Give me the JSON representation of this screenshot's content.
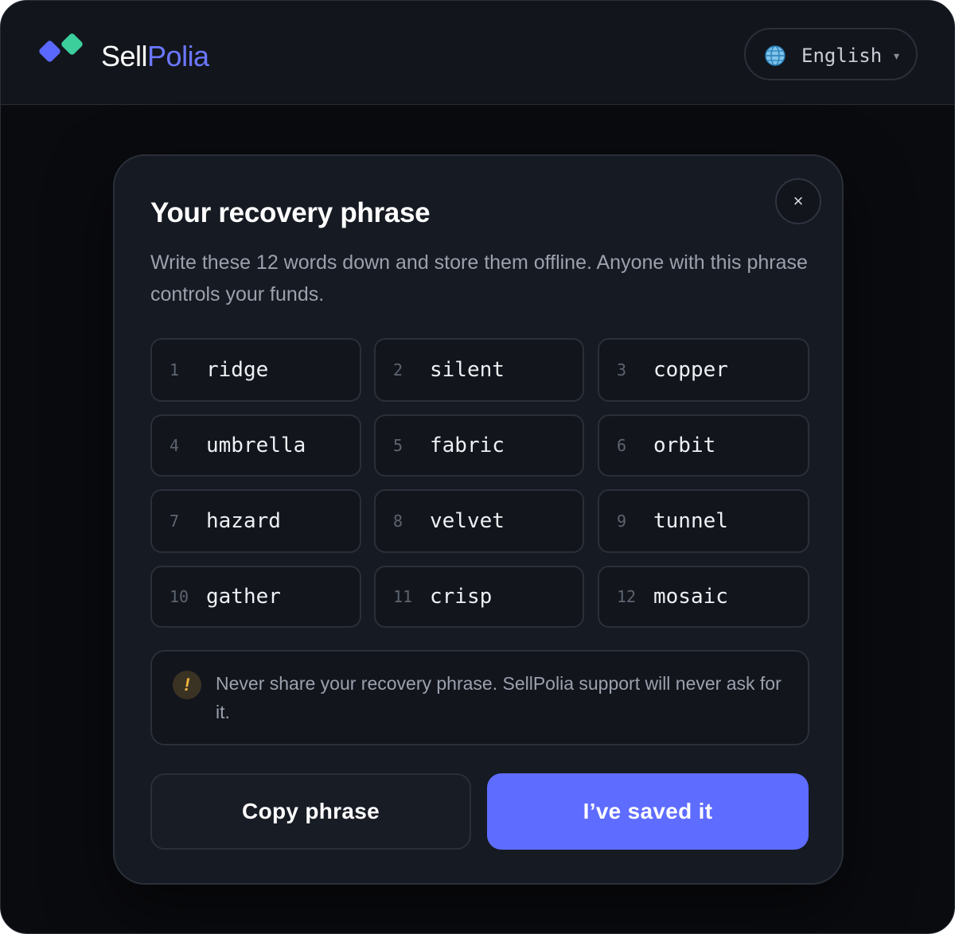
{
  "brand": {
    "name_part1": "Sell",
    "name_part2": "Polia",
    "accent_color": "#6b78ff",
    "mark_colors": [
      "#5b68ff",
      "#3ccf9c"
    ]
  },
  "language": {
    "selected": "English",
    "icon": "globe-icon",
    "caret_icon": "chevron-down-icon"
  },
  "modal": {
    "close_icon": "close-icon",
    "close_glyph": "×",
    "title": "Your recovery phrase",
    "subtitle": "Write these 12 words down and store them offline. Anyone with this phrase controls your funds.",
    "words": [
      {
        "num": "1",
        "word": "ridge"
      },
      {
        "num": "2",
        "word": "silent"
      },
      {
        "num": "3",
        "word": "copper"
      },
      {
        "num": "4",
        "word": "umbrella"
      },
      {
        "num": "5",
        "word": "fabric"
      },
      {
        "num": "6",
        "word": "orbit"
      },
      {
        "num": "7",
        "word": "hazard"
      },
      {
        "num": "8",
        "word": "velvet"
      },
      {
        "num": "9",
        "word": "tunnel"
      },
      {
        "num": "10",
        "word": "gather"
      },
      {
        "num": "11",
        "word": "crisp"
      },
      {
        "num": "12",
        "word": "mosaic"
      }
    ],
    "warning": {
      "icon": "warning-icon",
      "glyph": "!",
      "text": "Never share your recovery phrase. SellPolia support will never ask for it."
    },
    "copy_button": "Copy phrase",
    "saved_button": "I’ve saved it",
    "primary_color": "#5e6cff"
  }
}
